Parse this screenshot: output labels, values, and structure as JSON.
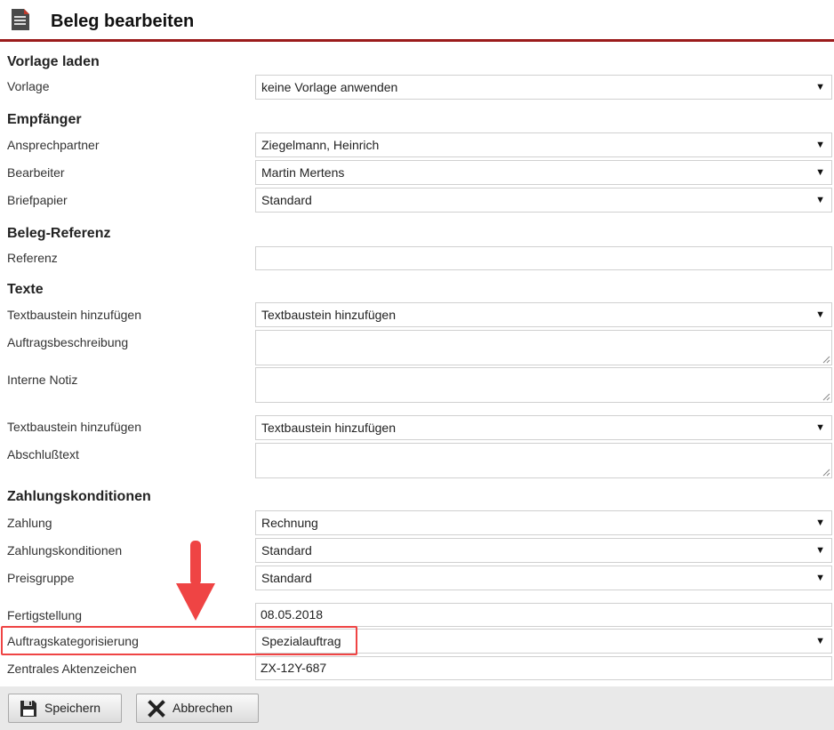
{
  "header": {
    "title": "Beleg bearbeiten",
    "icon": "document-icon"
  },
  "sections": {
    "vorlage_laden": "Vorlage laden",
    "empfaenger": "Empfänger",
    "beleg_referenz": "Beleg-Referenz",
    "texte": "Texte",
    "zahlungskonditionen": "Zahlungskonditionen"
  },
  "fields": {
    "vorlage": {
      "label": "Vorlage",
      "value": "keine Vorlage anwenden"
    },
    "ansprechpartner": {
      "label": "Ansprechpartner",
      "value": "Ziegelmann, Heinrich"
    },
    "bearbeiter": {
      "label": "Bearbeiter",
      "value": "Martin Mertens"
    },
    "briefpapier": {
      "label": "Briefpapier",
      "value": "Standard"
    },
    "referenz": {
      "label": "Referenz",
      "value": ""
    },
    "textbaustein1": {
      "label": "Textbaustein hinzufügen",
      "value": "Textbaustein hinzufügen"
    },
    "auftragsbeschreibung": {
      "label": "Auftragsbeschreibung",
      "value": ""
    },
    "interne_notiz": {
      "label": "Interne Notiz",
      "value": ""
    },
    "textbaustein2": {
      "label": "Textbaustein hinzufügen",
      "value": "Textbaustein hinzufügen"
    },
    "abschlusstext": {
      "label": "Abschlußtext",
      "value": ""
    },
    "zahlung": {
      "label": "Zahlung",
      "value": "Rechnung"
    },
    "zahlungskonditionen": {
      "label": "Zahlungskonditionen",
      "value": "Standard"
    },
    "preisgruppe": {
      "label": "Preisgruppe",
      "value": "Standard"
    },
    "fertigstellung": {
      "label": "Fertigstellung",
      "value": "08.05.2018"
    },
    "auftragskategorisierung": {
      "label": "Auftragskategorisierung",
      "value": "Spezialauftrag"
    },
    "zentrales_aktenzeichen": {
      "label": "Zentrales Aktenzeichen",
      "value": "ZX-12Y-687"
    }
  },
  "dropdown_caret": "▼",
  "annotation": {
    "highlight_color": "#ef4444",
    "arrow_icon": "arrow-down-icon"
  },
  "footer": {
    "save_label": "Speichern",
    "cancel_label": "Abbrechen",
    "save_icon": "floppy-disk-icon",
    "cancel_icon": "close-icon"
  },
  "colors": {
    "accent": "#9b1b1b",
    "footer_bg": "#e9e9e9"
  }
}
